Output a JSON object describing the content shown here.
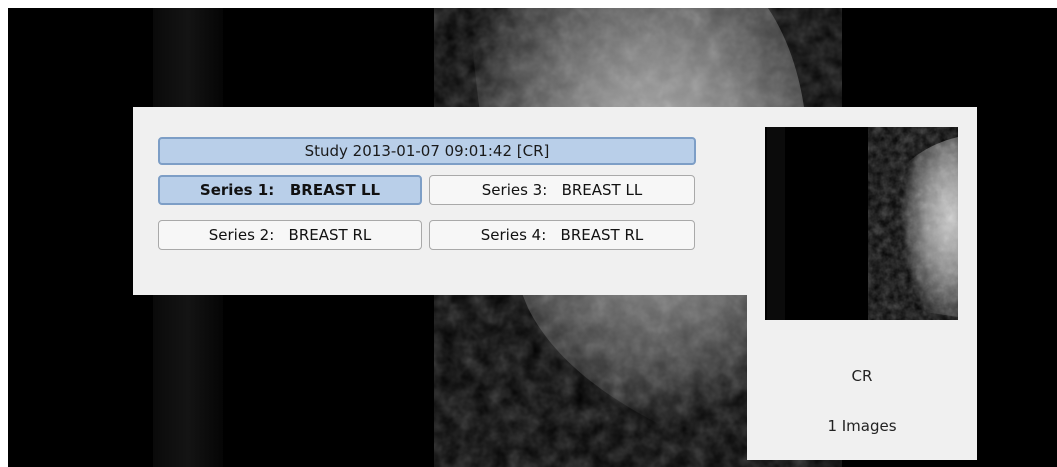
{
  "study": {
    "label": "Study 2013-01-07 09:01:42 [CR]"
  },
  "series": [
    {
      "label": "Series 1:   BREAST LL",
      "selected": true
    },
    {
      "label": "Series 3:   BREAST LL",
      "selected": false
    },
    {
      "label": "Series 2:   BREAST RL",
      "selected": false
    },
    {
      "label": "Series 4:   BREAST RL",
      "selected": false
    }
  ],
  "thumbnail": {
    "modality": "CR",
    "image_count": "1 Images"
  },
  "colors": {
    "selected_fill": "#b9cfe9",
    "selected_border": "#7d9ec6",
    "panel_bg": "#f0f0f0",
    "viewport_bg": "#000000"
  }
}
